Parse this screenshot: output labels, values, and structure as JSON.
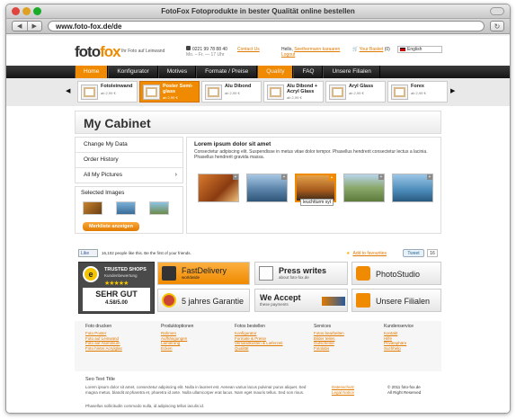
{
  "window": {
    "title": "FotoFox Fotoprodukte in bester Qualität online bestellen"
  },
  "toolbar": {
    "back": "◀",
    "forward": "▶",
    "url": "www.foto-fox.de/de",
    "reload": "↻"
  },
  "header": {
    "logo_a": "foto",
    "logo_b": "fox",
    "tagline": "Ihr Foto auf Leinwand",
    "phone": "0221 99 78 88 40",
    "phone_hours": "Mo. – Fr. — 17 Uhr",
    "contact": "Contact Us",
    "hello": "Hello,",
    "user": "Seethermann karaaren",
    "logout": "Logout",
    "basket_label": "Your Basket",
    "basket_count": "(0)",
    "language": "English"
  },
  "nav": {
    "items": [
      "Home",
      "Konfigurator",
      "Motives",
      "Formate / Preise",
      "Quality",
      "FAQ",
      "Unsere Filialen"
    ]
  },
  "carousel": {
    "prev": "◀",
    "next": "▶",
    "products": [
      {
        "name": "Fotoleinwand",
        "price": "ab 2,99 €"
      },
      {
        "name": "Poster Semi-glass",
        "price": "ab 2,99 €"
      },
      {
        "name": "Alu Dibond",
        "price": "ab 2,99 €"
      },
      {
        "name": "Alu Dibond + Acryl Glass",
        "price": "ab 2,99 €"
      },
      {
        "name": "Aryl Glass",
        "price": "ab 2,99 €"
      },
      {
        "name": "Forex",
        "price": "ab 2,99 €"
      }
    ]
  },
  "cabinet": {
    "title": "My Cabinet",
    "menu": [
      "Change My Data",
      "Order History",
      "All My Pictures"
    ],
    "chevron": "›",
    "selected_label": "Selected Images",
    "merkliste": "Merkliste anzeigen",
    "heading": "Lorem ipsum dolor sit amet",
    "text": "Consectetur adipiscing elit. Suspendisse in metus vitae dolor tempor. Phasellus hendrerit consectetur lectus a lacinia. Phasellus hendrerit gravida massa.",
    "plus": "+",
    "caption": "leuchtturm syt"
  },
  "social": {
    "like": "Like",
    "like_text": "16,102 people like this. Be the first of your friends.",
    "favourites": "Add to favourites",
    "tweet": "Tweet",
    "tweet_count": "16"
  },
  "badges": {
    "trusted_title": "TRUSTED SHOPS",
    "trusted_sub": "Kundenbewertung",
    "trusted_seal": "e",
    "trusted_stars": "★★★★★",
    "trusted_grade": "SEHR GUT",
    "trusted_score": "4.58/5.00",
    "delivery_big": "FastDelivery",
    "delivery_small": "worldwide",
    "press_big": "Press writes",
    "press_small": "about foto-fox.de",
    "studio_big": "PhotoStudio",
    "guarantee_big": "5 jahres Garantie",
    "accept_big": "We Accept",
    "accept_small": "these payments",
    "filialen_big": "Unsere Filialen"
  },
  "footer": {
    "columns": [
      {
        "title": "Foto drucken",
        "links": [
          "Foto Poster",
          "Foto auf Leinwand",
          "Foto auf Aluminium",
          "Foto hinter Acrylglas"
        ]
      },
      {
        "title": "Produktoptionen",
        "links": [
          "Rahmen",
          "Aufhängungen",
          "Lamierung",
          "Ecken"
        ]
      },
      {
        "title": "Fotos bestellen",
        "links": [
          "Konfigurator",
          "Formate & Preise",
          "Versandkosten & Lieferzeit",
          "Qualität"
        ]
      },
      {
        "title": "Services",
        "links": [
          "Fotos bearbeiten",
          "Bilder teilen",
          "Gutscheine",
          "Fotolabs"
        ]
      },
      {
        "title": "Kundenservice",
        "links": [
          "Kontakt",
          "Hilfe",
          "Privatsphäre",
          "Suchhelp"
        ]
      }
    ]
  },
  "seo": {
    "title": "Seo Text Title",
    "p1": "Lorem ipsum dolor sit amet, consectetur adipiscing elit. Nulla in laoreet est. Aenean varius lacus pulvinar purus aliquet. Sed magna metus, blandit at pharetra et, pharetra id ante. Nulla ullamcorper erat lacus. Nam eget mauris tellus. Sed non risus.",
    "p2": "Phasellus sollicitudin commodo nulla, id adipiscing tellus iaculis id.",
    "links": [
      "Datenschutz",
      "Legal Notice"
    ],
    "copyright": "© 2011 foto-fox.de",
    "rights": "All Right Reserved"
  },
  "colors": {
    "accent": "#f08a00",
    "nav_bg": "#1e1e1e",
    "link": "#e07a00"
  }
}
